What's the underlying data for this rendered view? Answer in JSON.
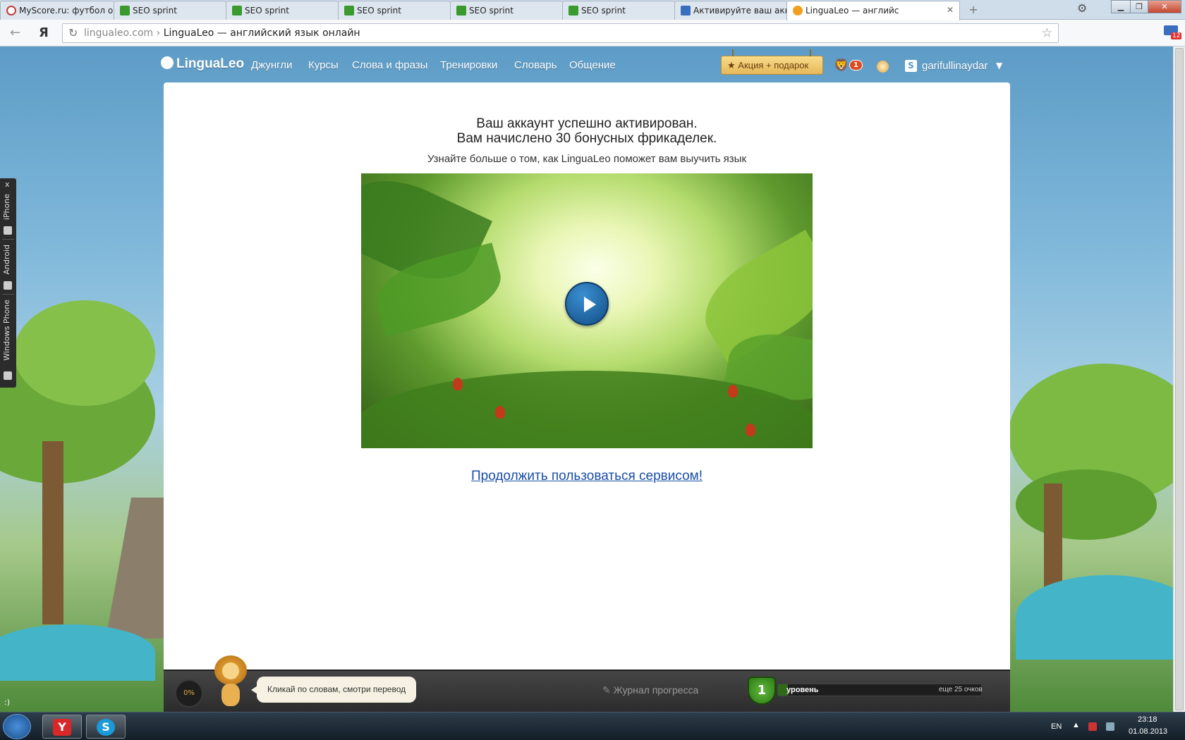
{
  "browser": {
    "tabs": [
      {
        "title": "MyScore.ru: футбол о",
        "favicon": "myscore",
        "active": false
      },
      {
        "title": "SEO sprint",
        "favicon": "seo-sprint",
        "active": false
      },
      {
        "title": "SEO sprint",
        "favicon": "seo-sprint",
        "active": false
      },
      {
        "title": "SEO sprint",
        "favicon": "seo-sprint",
        "active": false
      },
      {
        "title": "SEO sprint",
        "favicon": "seo-sprint",
        "active": false
      },
      {
        "title": "SEO sprint",
        "favicon": "seo-sprint",
        "active": false
      },
      {
        "title": "Активируйте ваш акк",
        "favicon": "activate",
        "active": false
      },
      {
        "title": "LinguaLeo — английс",
        "favicon": "lingualeo",
        "active": true
      }
    ],
    "new_tab_icon": "plus-icon",
    "yandex_label": "Я",
    "url_host": "lingualeo.com",
    "url_sep": "›",
    "url_title": "LinguaLeo — английский язык онлайн",
    "mail_badge": "12"
  },
  "site": {
    "logo_text": "LinguaLeo",
    "nav": [
      "Джунгли",
      "Курсы",
      "Слова и фразы",
      "Тренировки",
      "Словарь",
      "Общение"
    ],
    "promo_label": "Акция + подарок",
    "notif_count": "1",
    "username": "garifullinaydar",
    "user_icon_letter": "S"
  },
  "main": {
    "heading_line1": "Ваш аккаунт успешно активирован.",
    "heading_line2": "Вам начислено 30 бонусных фрикаделек.",
    "subtext": "Узнайте больше о том, как LinguaLeo поможет вам выучить язык",
    "continue_link": "Продолжить пользоваться сервисом!"
  },
  "side_panel": {
    "close": "x",
    "items": [
      "iPhone",
      "Android",
      "Windows Phone"
    ]
  },
  "bottom_bar": {
    "progress": "0%",
    "hint": "Кликай по словам, смотри перевод",
    "journal": "Журнал прогресса",
    "level_number": "1",
    "level_label": "уровень",
    "level_remaining": "еще 25 очков",
    "level_progress": 0.05
  },
  "taskbar": {
    "smiley": ":)",
    "lang": "EN",
    "time": "23:18",
    "date": "01.08.2013"
  },
  "colors": {
    "accent_link": "#1a4ea8",
    "header_blue": "#5a9ac4",
    "promo_gold": "#e6b85a",
    "level_green": "#2e7a16"
  }
}
